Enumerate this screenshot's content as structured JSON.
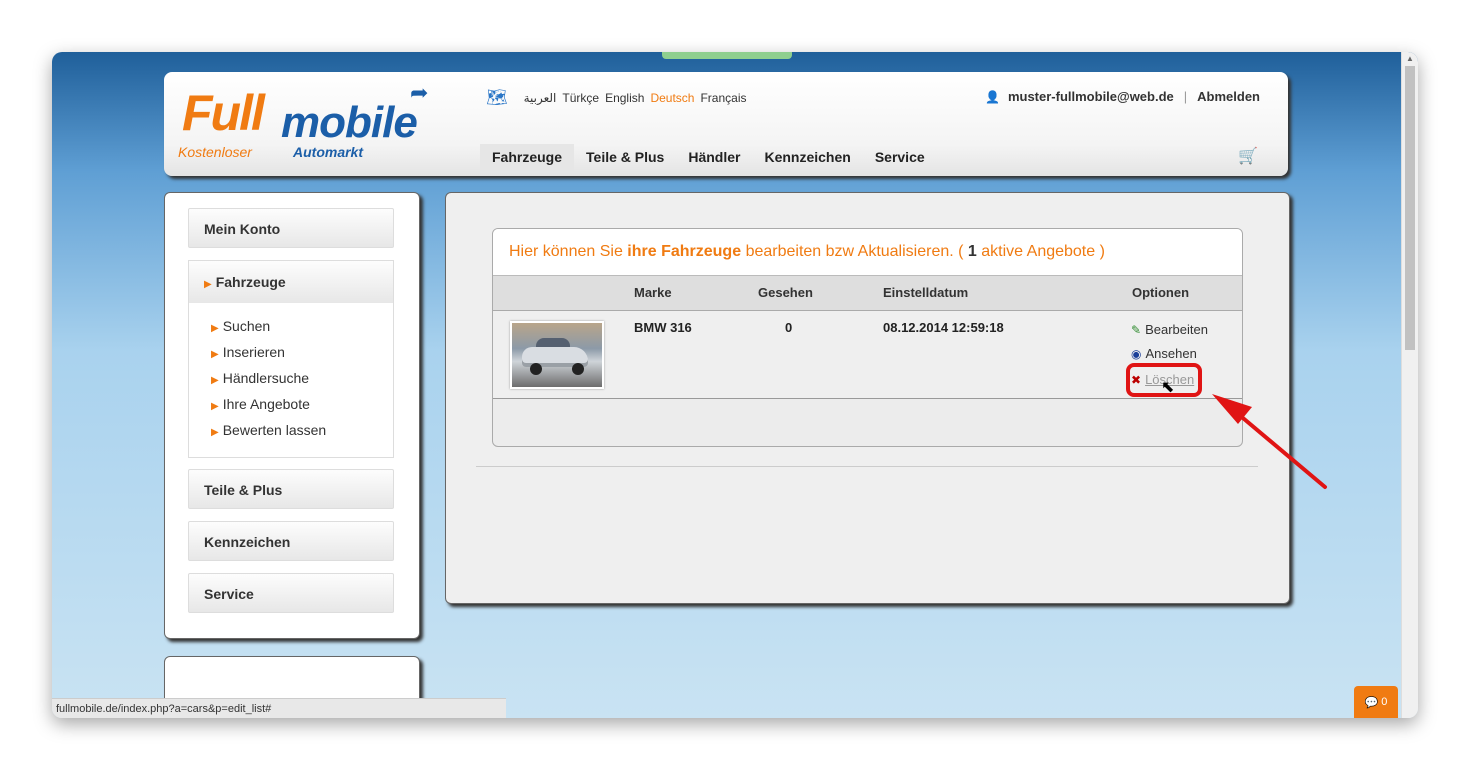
{
  "header": {
    "logo": {
      "full": "Full",
      "mobile": "mobile",
      "tag1": "Kostenloser",
      "tag2": "Automarkt"
    },
    "languages": [
      "العربية",
      "Türkçe",
      "English",
      "Deutsch",
      "Français"
    ],
    "active_language": "Deutsch",
    "user_email": "muster-fullmobile@web.de",
    "logout": "Abmelden",
    "nav": [
      "Fahrzeuge",
      "Teile & Plus",
      "Händler",
      "Kennzeichen",
      "Service"
    ]
  },
  "sidebar": {
    "my_account": "Mein Konto",
    "vehicles": "Fahrzeuge",
    "vehicle_items": [
      "Suchen",
      "Inserieren",
      "Händlersuche",
      "Ihre Angebote",
      "Bewerten lassen"
    ],
    "parts": "Teile & Plus",
    "plates": "Kennzeichen",
    "service": "Service"
  },
  "panel": {
    "title_pre": "Hier können Sie",
    "title_bold": "ihre Fahrzeuge",
    "title_mid": "bearbeiten bzw Aktualisieren. (",
    "count": "1",
    "title_post": "aktive Angebote )",
    "columns": [
      "Marke",
      "Gesehen",
      "Einstelldatum",
      "Optionen"
    ],
    "row": {
      "brand": "BMW 316",
      "views": "0",
      "date": "08.12.2014 12:59:18",
      "edit": "Bearbeiten",
      "view": "Ansehen",
      "delete": "Löschen"
    }
  },
  "status_url": "fullmobile.de/index.php?a=cars&p=edit_list#",
  "chat_count": "0",
  "colors": {
    "accent": "#f07b12",
    "brand_blue": "#1b5ea8",
    "highlight_red": "#e01414"
  }
}
